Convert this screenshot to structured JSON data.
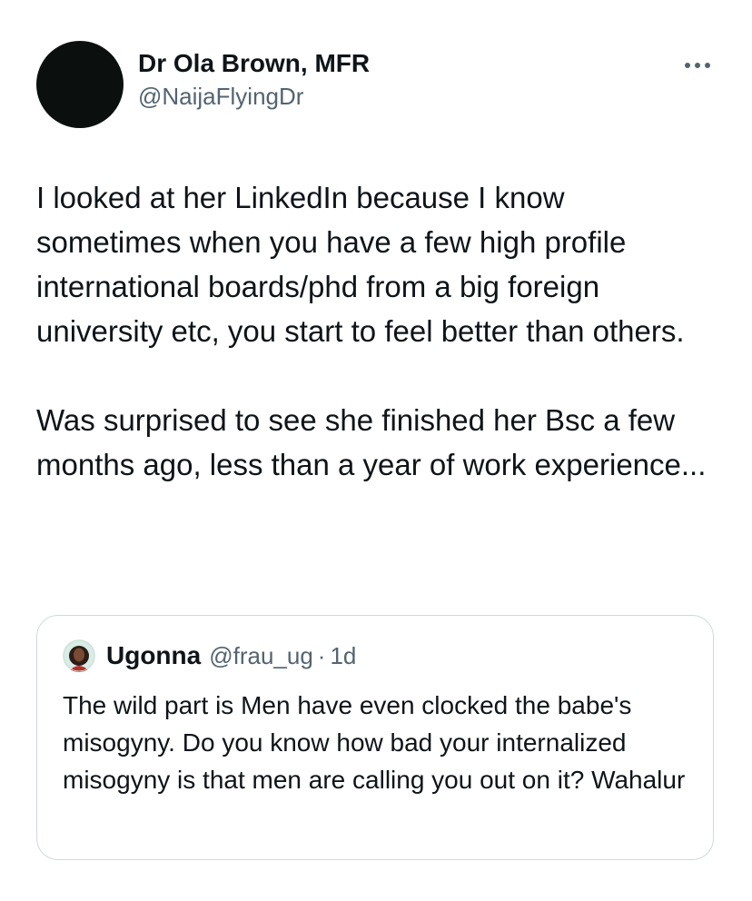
{
  "tweet": {
    "author_name": "Dr Ola Brown, MFR",
    "author_handle": "@NaijaFlyingDr",
    "text": "I looked at her LinkedIn because I know sometimes when you have a few high profile international boards/phd from a big foreign university etc, you start to feel better than others.\n\nWas surprised to see she finished her Bsc a few months ago, less than a year of work experience...",
    "more_icon": "more-horizontal-icon"
  },
  "quote": {
    "author_name": "Ugonna",
    "author_handle": "@frau_ug",
    "separator": "·",
    "time": "1d",
    "text": "The wild part is Men have even clocked the babe's misogyny. Do you know how bad your internalized misogyny is that men are calling you out on it? Wahalur"
  },
  "colors": {
    "text_primary": "#0f1419",
    "text_secondary": "#536471",
    "border": "#cfd9de",
    "avatar_dark": "#0b0f0d"
  }
}
